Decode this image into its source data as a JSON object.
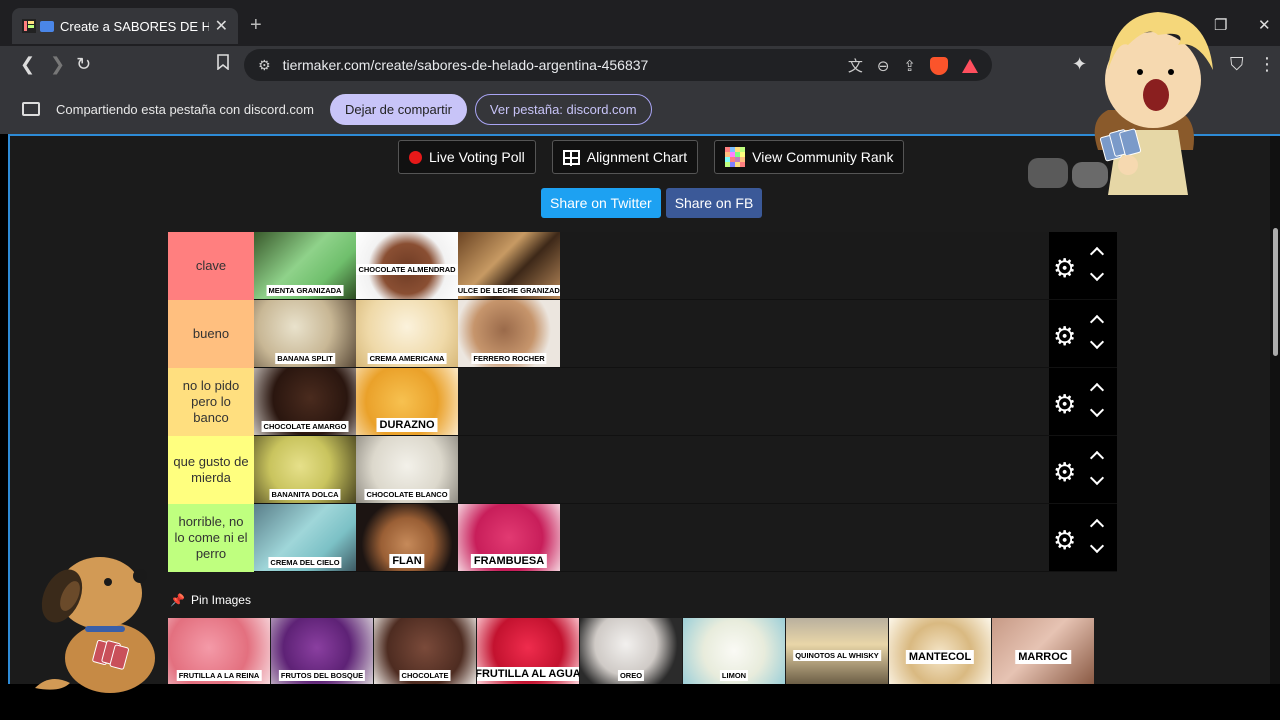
{
  "browser": {
    "tab_title": "Create a SABORES DE HELADO",
    "url": "tiermaker.com/create/sabores-de-helado-argentina-456837",
    "share_text": "Compartiendo esta pestaña con discord.com",
    "stop_sharing_label": "Dejar de compartir",
    "view_tab_label": "Ver pestaña: discord.com"
  },
  "toolbar": {
    "live_voting": "Live Voting Poll",
    "alignment_chart": "Alignment Chart",
    "community_rank": "View Community Rank",
    "share_twitter": "Share on Twitter",
    "share_fb": "Share on FB"
  },
  "tiers": [
    {
      "label": "clave",
      "color": "#ff7f7f",
      "items": [
        {
          "label": "MENTA GRANIZADA",
          "bg": "linear-gradient(135deg,#3a5a2c,#8fd28a 45%,#6fbf6c 70%,#2e4c22)"
        },
        {
          "label": "CHOCOLATE ALMENDRAD",
          "bg": "radial-gradient(circle at 50% 55%,#6e3b24,#8a4f33 40%,#f2f2f2 62%,#fff)",
          "mid": true
        },
        {
          "label": "DULCE DE LECHE GRANIZADO",
          "bg": "linear-gradient(135deg,#6b4423,#c79a63 40%,#3d2818 60%,#b8895a)"
        }
      ]
    },
    {
      "label": "bueno",
      "color": "#ffbf7f",
      "items": [
        {
          "label": "BANANA SPLIT",
          "bg": "radial-gradient(circle at 40% 40%,#e9e2cc,#c8b795 50%,#5a4a38)"
        },
        {
          "label": "CREMA AMERICANA",
          "bg": "radial-gradient(circle at 50% 40%,#fbf2dc,#efd9a8 60%,#d7b879)"
        },
        {
          "label": "FERRERO ROCHER",
          "bg": "radial-gradient(circle at 45% 45%,#9a6a4a,#c6956c 45%,#ece6df 70%)"
        }
      ]
    },
    {
      "label": "no lo pido pero lo banco",
      "color": "#ffdf7f",
      "items": [
        {
          "label": "CHOCOLATE AMARGO",
          "bg": "radial-gradient(circle at 55% 45%,#4a2b1e,#2a160f 55%,#c8c2bd)"
        },
        {
          "label": "DURAZNO",
          "bg": "radial-gradient(circle at 45% 50%,#f7c150,#eaa12a 55%,#fbe9c7)",
          "big": true
        }
      ]
    },
    {
      "label": "que gusto de mierda",
      "color": "#ffff7f",
      "items": [
        {
          "label": "BANANITA DOLCA",
          "bg": "radial-gradient(circle at 45% 45%,#e6e08a,#c9c45e 45%,#4a4520)"
        },
        {
          "label": "CHOCOLATE BLANCO",
          "bg": "radial-gradient(circle at 50% 45%,#f3f1ea,#dcd8cc 55%,#8f8b82)"
        }
      ]
    },
    {
      "label": "horrible, no lo come ni el perro",
      "color": "#bfff7f",
      "items": [
        {
          "label": "CREMA DEL CIELO",
          "bg": "linear-gradient(135deg,#5a7f8a,#9fd6d9 45%,#7cc1c6 70%,#3e5a63)"
        },
        {
          "label": "FLAN",
          "bg": "radial-gradient(circle at 50% 60%,#c68a5a,#9a5f35 40%,#1c1412 70%)",
          "big": true
        },
        {
          "label": "FRAMBUESA",
          "bg": "radial-gradient(circle at 50% 50%,#e23a72,#c81e5a 55%,#f4d2dd)",
          "big": true
        }
      ]
    }
  ],
  "pin_label": "Pin Images",
  "pool": [
    {
      "label": "FRUTILLA A LA REINA",
      "bg": "radial-gradient(circle at 40% 45%,#f49aa8,#e3707f 55%,#f7d8dd)"
    },
    {
      "label": "FRUTOS DEL BOSQUE",
      "bg": "radial-gradient(circle at 45% 45%,#8a3fa0,#5e2276 50%,#d9d3d8)"
    },
    {
      "label": "CHOCOLATE",
      "bg": "radial-gradient(circle at 50% 45%,#7a4a3a,#4e2c21 60%,#ede8e4)"
    },
    {
      "label": "FRUTILLA AL AGUA",
      "bg": "radial-gradient(circle at 50% 45%,#ef2c4d,#c3122f 55%,#ffd5dc)",
      "big": true
    },
    {
      "label": "OREO",
      "bg": "radial-gradient(circle at 45% 40%,#f2f0ee,#cfcac6 45%,#2b2b2b 75%)"
    },
    {
      "label": "LIMON",
      "bg": "radial-gradient(circle at 50% 50%,#fafaf5,#e8ecdc 50%,#9ccfd8)"
    },
    {
      "label": "QUINOTOS AL WHISKY",
      "bg": "linear-gradient(180deg,#b9b09e,#e9d6a8 40%,#6c5e46)",
      "mid": true
    },
    {
      "label": "MANTECOL",
      "bg": "radial-gradient(circle at 50% 55%,#f5e6c9,#d9b981 50%,#fdf7ea)",
      "big": true,
      "mid": true
    },
    {
      "label": "MARROC",
      "bg": "linear-gradient(135deg,#c79a86,#e6c3b3 45%,#8a5a44)",
      "big": true,
      "mid": true
    }
  ],
  "icons": {
    "back": "back-arrow-icon",
    "forward": "forward-arrow-icon",
    "reload": "reload-icon",
    "bookmark": "bookmark-icon",
    "gear": "gear-icon"
  }
}
